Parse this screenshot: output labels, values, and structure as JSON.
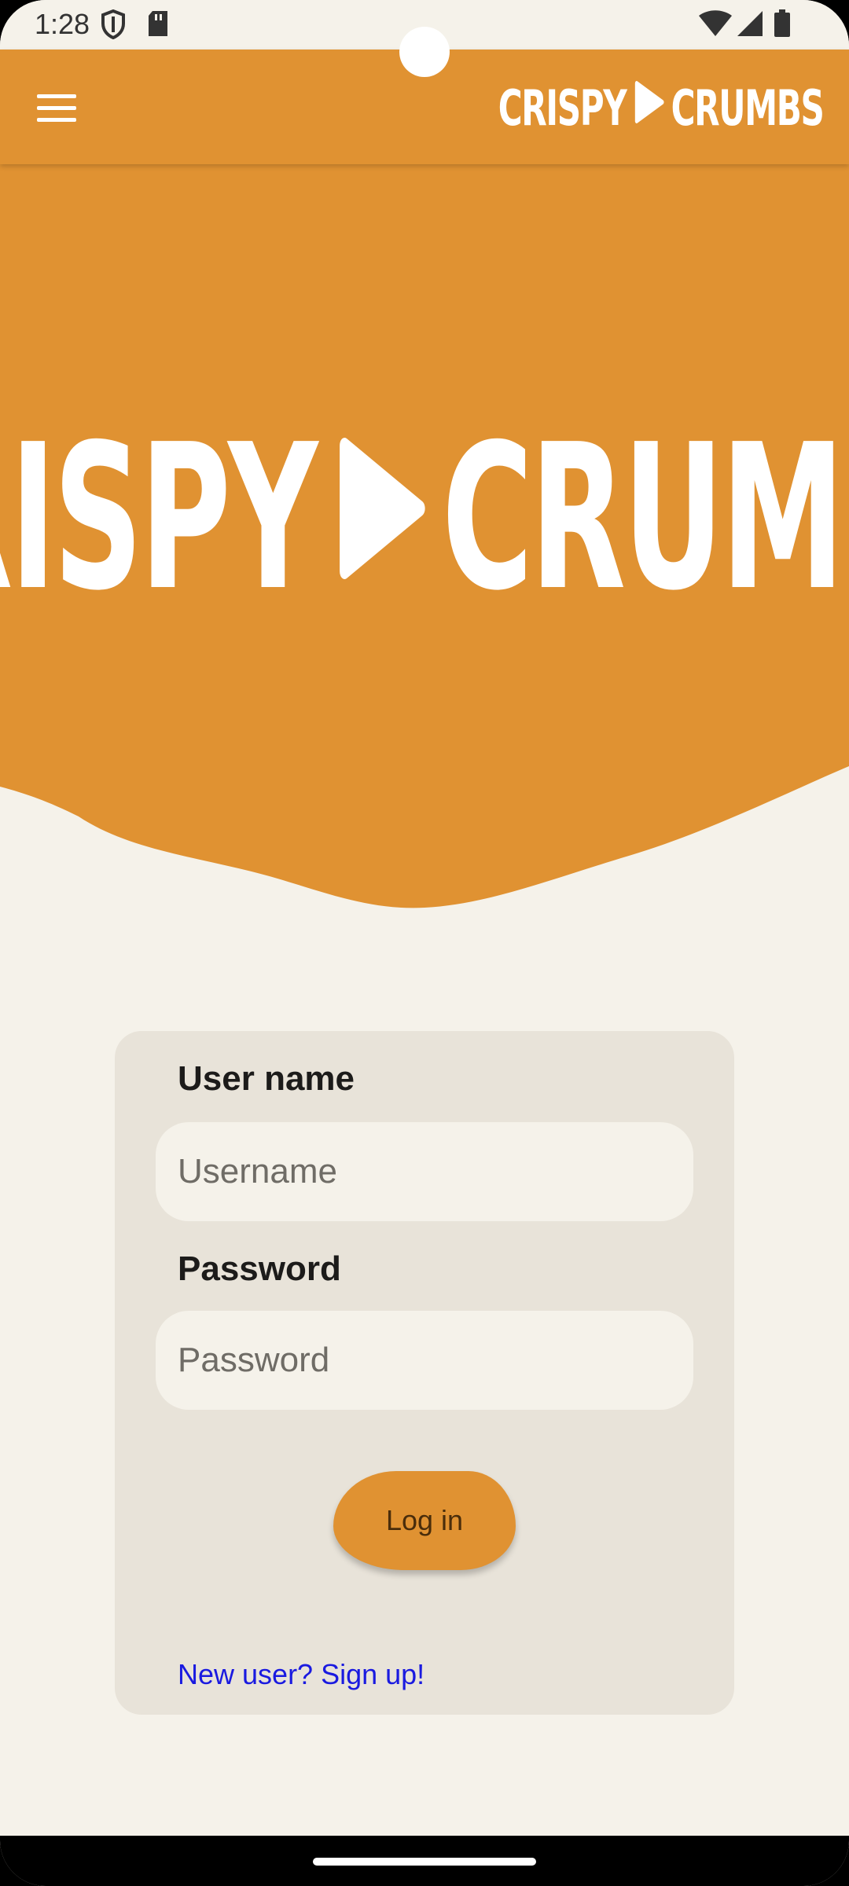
{
  "status_bar": {
    "time": "1:28",
    "icons_left": [
      "shield-icon",
      "sd-card-icon"
    ],
    "icons_right": [
      "wifi-icon",
      "signal-icon",
      "battery-icon"
    ]
  },
  "app_bar": {
    "menu_icon": "hamburger-menu-icon",
    "logo_word_1": "CRISPY",
    "logo_word_2": "CRUMBS",
    "logo_glyph": "▶"
  },
  "hero": {
    "logo_word_1": "CRISPY",
    "logo_word_2": "CRUMBS",
    "logo_glyph": "▶"
  },
  "login": {
    "username_label": "User name",
    "username_placeholder": "Username",
    "username_value": "",
    "password_label": "Password",
    "password_placeholder": "Password",
    "password_value": "",
    "login_button_label": "Log in",
    "signup_link_text": "New user? Sign up!"
  },
  "colors": {
    "brand_orange": "#e09232",
    "background": "#f5f2ea",
    "card": "#e8e3d9",
    "link": "#1a1ae0"
  }
}
